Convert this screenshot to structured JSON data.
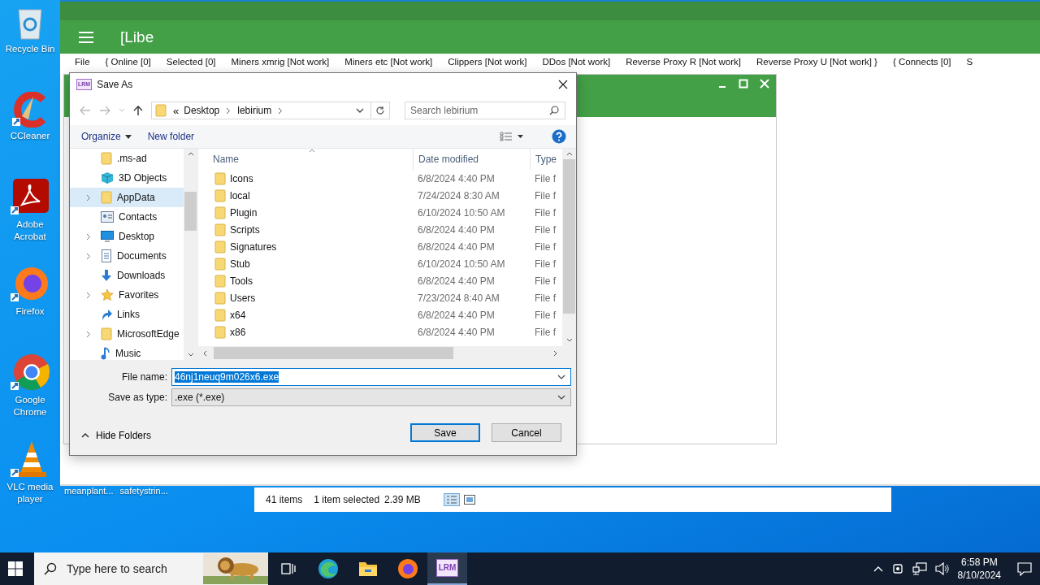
{
  "desktop_icons": [
    {
      "kind": "recycle",
      "label": "Recycle Bin"
    },
    {
      "kind": "ccleaner",
      "label": "CCleaner"
    },
    {
      "kind": "acrobat",
      "label": "Adobe Acrobat"
    },
    {
      "kind": "firefox",
      "label": "Firefox"
    },
    {
      "kind": "chrome",
      "label": "Google Chrome"
    },
    {
      "kind": "vlc",
      "label": "VLC media player"
    }
  ],
  "desktop_files": [
    "meanplant...",
    "safetystrin..."
  ],
  "app": {
    "title": "[Libe",
    "menu": [
      "File",
      "{ Online [0]",
      "Selected [0]",
      "Miners xmrig [Not work]",
      "Miners etc [Not work]",
      "Clippers [Not work]",
      "DDos [Not work]",
      "Reverse Proxy R [Not work]",
      "Reverse Proxy U [Not work] }",
      "{ Connects [0]",
      "S"
    ]
  },
  "dialog": {
    "icon_text": "LRM",
    "title": "Save As",
    "path_overflow": "«",
    "path": [
      "Desktop",
      "lebirium"
    ],
    "search": {
      "placeholder": "Search lebirium"
    },
    "organize": "Organize",
    "new_folder": "New folder",
    "tree": [
      {
        "kind": "folder",
        "label": ".ms-ad",
        "expandable": false,
        "selected": false
      },
      {
        "kind": "cube",
        "label": "3D Objects",
        "expandable": false,
        "selected": false
      },
      {
        "kind": "folder",
        "label": "AppData",
        "expandable": true,
        "selected": true
      },
      {
        "kind": "contacts",
        "label": "Contacts",
        "expandable": false,
        "selected": false
      },
      {
        "kind": "desktop",
        "label": "Desktop",
        "expandable": true,
        "selected": false
      },
      {
        "kind": "documents",
        "label": "Documents",
        "expandable": true,
        "selected": false
      },
      {
        "kind": "downloads",
        "label": "Downloads",
        "expandable": false,
        "selected": false
      },
      {
        "kind": "star",
        "label": "Favorites",
        "expandable": true,
        "selected": false
      },
      {
        "kind": "links",
        "label": "Links",
        "expandable": false,
        "selected": false
      },
      {
        "kind": "folder",
        "label": "MicrosoftEdge",
        "expandable": true,
        "selected": false
      },
      {
        "kind": "music",
        "label": "Music",
        "expandable": false,
        "selected": false
      }
    ],
    "columns": [
      "Name",
      "Date modified",
      "Type"
    ],
    "files": [
      {
        "name": "Icons",
        "date": "6/8/2024 4:40 PM",
        "type": "File f"
      },
      {
        "name": "local",
        "date": "7/24/2024 8:30 AM",
        "type": "File f"
      },
      {
        "name": "Plugin",
        "date": "6/10/2024 10:50 AM",
        "type": "File f"
      },
      {
        "name": "Scripts",
        "date": "6/8/2024 4:40 PM",
        "type": "File f"
      },
      {
        "name": "Signatures",
        "date": "6/8/2024 4:40 PM",
        "type": "File f"
      },
      {
        "name": "Stub",
        "date": "6/10/2024 10:50 AM",
        "type": "File f"
      },
      {
        "name": "Tools",
        "date": "6/8/2024 4:40 PM",
        "type": "File f"
      },
      {
        "name": "Users",
        "date": "7/23/2024 8:40 AM",
        "type": "File f"
      },
      {
        "name": "x64",
        "date": "6/8/2024 4:40 PM",
        "type": "File f"
      },
      {
        "name": "x86",
        "date": "6/8/2024 4:40 PM",
        "type": "File f"
      }
    ],
    "file_name_label": "File name:",
    "file_name": "46nj1neuq9m026x6.exe",
    "type_label": "Save as type:",
    "save_type": ".exe (*.exe)",
    "hide_folders": "Hide Folders",
    "buttons": [
      {
        "label": "Save",
        "default": true
      },
      {
        "label": "Cancel",
        "default": false
      }
    ]
  },
  "explorer_status": {
    "count": "41 items",
    "selection": "1 item selected",
    "size": "2.39 MB"
  },
  "taskbar": {
    "search_placeholder": "Type here to search",
    "apps": [
      {
        "kind": "taskview",
        "active": false
      },
      {
        "kind": "edge",
        "active": false
      },
      {
        "kind": "explorer",
        "active": false
      },
      {
        "kind": "firefox",
        "active": false
      },
      {
        "kind": "lrm",
        "active": true
      }
    ],
    "app_text": "LRM",
    "time": "6:58 PM",
    "date": "8/10/2024"
  }
}
